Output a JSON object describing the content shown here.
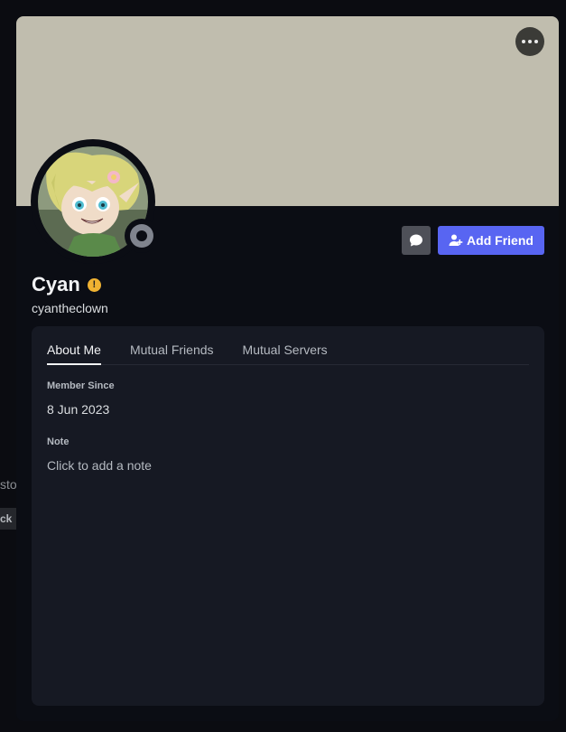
{
  "background": {
    "partial_text": "sto",
    "partial_button": "ck"
  },
  "profile": {
    "banner_color": "#c0bdae",
    "display_name": "Cyan",
    "username": "cyantheclown",
    "status": "offline",
    "badge_icon": "warning-icon"
  },
  "actions": {
    "more_icon": "ellipsis-icon",
    "message_icon": "chat-bubble-icon",
    "add_friend_label": "Add Friend",
    "add_friend_icon": "add-friend-icon",
    "accent": "#5865f2"
  },
  "tabs": [
    {
      "label": "About Me",
      "active": true
    },
    {
      "label": "Mutual Friends",
      "active": false
    },
    {
      "label": "Mutual Servers",
      "active": false
    }
  ],
  "about": {
    "member_since_title": "Member Since",
    "member_since_value": "8 Jun 2023",
    "note_title": "Note",
    "note_placeholder": "Click to add a note"
  }
}
